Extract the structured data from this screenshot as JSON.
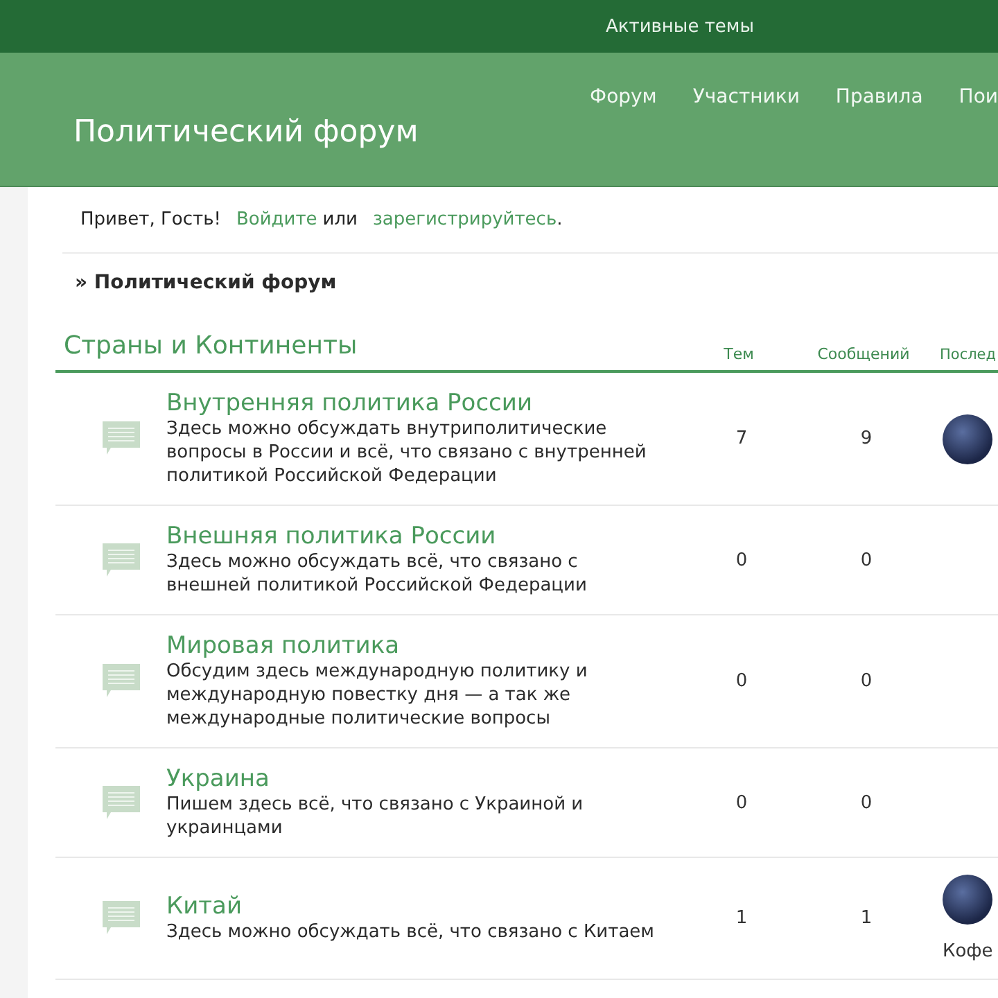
{
  "top_bar": {
    "link": "Активные темы"
  },
  "header": {
    "title": "Политический форум",
    "nav": [
      "Форум",
      "Участники",
      "Правила",
      "Пои"
    ]
  },
  "greeting": {
    "text": "Привет, Гость!",
    "login": "Войдите",
    "or": "или",
    "register": "зарегистрируйтесь",
    "end": "."
  },
  "breadcrumb": "» Политический форум",
  "category": {
    "title": "Страны и Континенты",
    "columns": [
      "Тем",
      "Сообщений",
      "Послед"
    ]
  },
  "forums": [
    {
      "title": "Внутренняя политика России",
      "description": "Здесь можно обсуждать внутриполитические вопросы в России и всё, что связано с внутренней политикой Российской Федерации",
      "topics": "7",
      "posts": "9",
      "last_poster_avatar": true
    },
    {
      "title": "Внешняя политика России",
      "description": "Здесь можно обсуждать всё, что связано с внешней политикой Российской Федерации",
      "topics": "0",
      "posts": "0",
      "last_poster_avatar": false
    },
    {
      "title": "Мировая политика",
      "description": "Обсудим здесь международную политику и международную повестку дня — а так же международные политические вопросы",
      "topics": "0",
      "posts": "0",
      "last_poster_avatar": false
    },
    {
      "title": "Украина",
      "description": "Пишем здесь всё, что связано с Украиной и украинцами",
      "topics": "0",
      "posts": "0",
      "last_poster_avatar": false
    },
    {
      "title": "Китай",
      "description": "Здесь можно обсуждать всё, что связано с Китаем",
      "topics": "1",
      "posts": "1",
      "last_poster_avatar": true,
      "last_poster": "Кофе"
    }
  ]
}
